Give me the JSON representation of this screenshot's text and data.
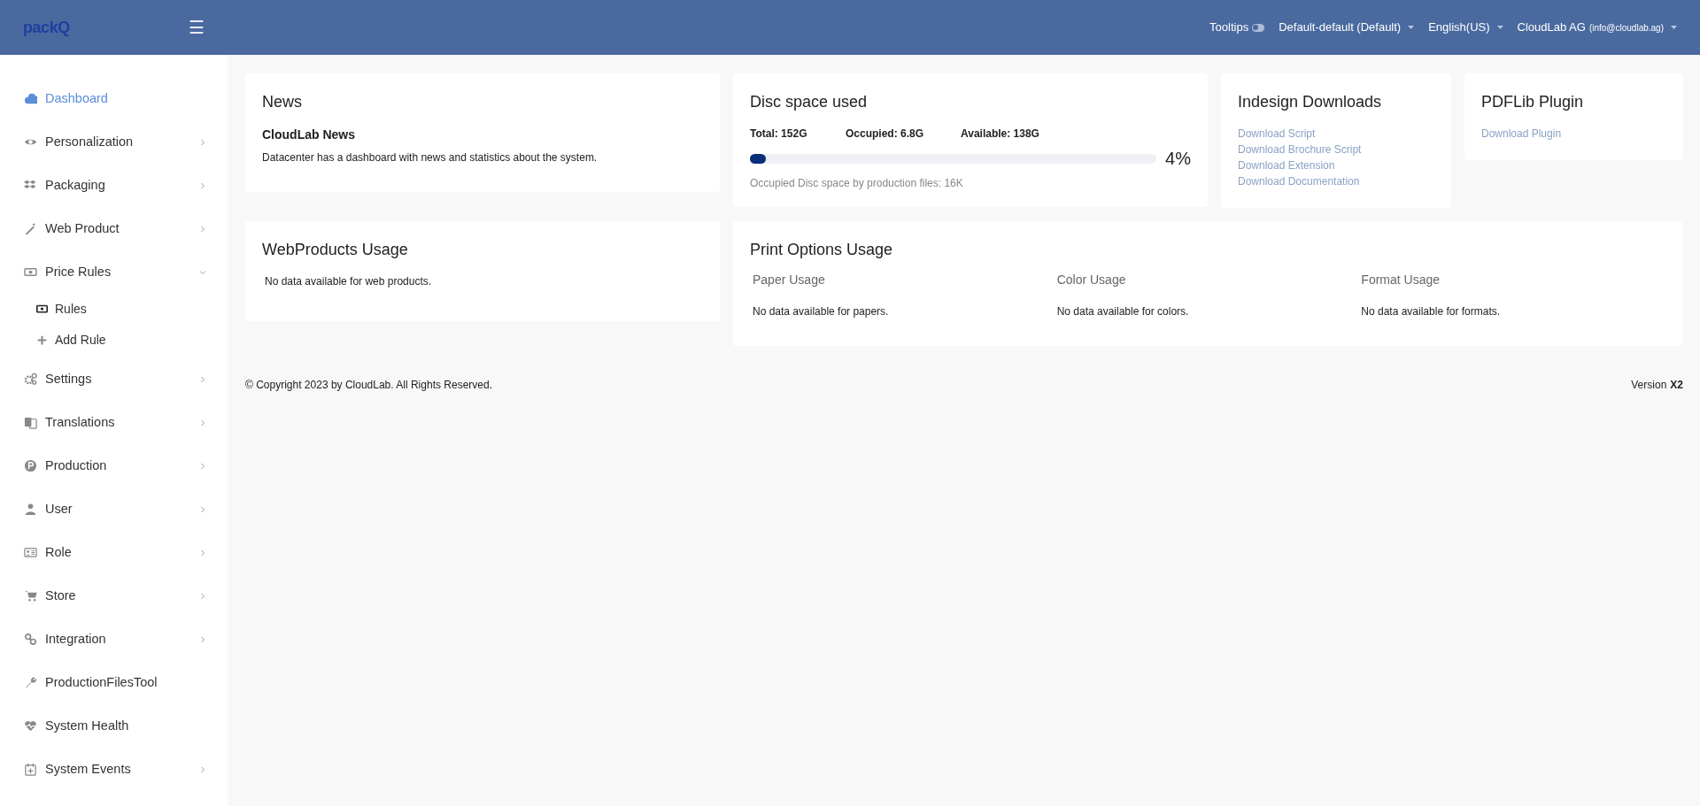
{
  "header": {
    "logo": "packQ",
    "menu_glyph": "☰",
    "tooltips": {
      "label": "Tooltips",
      "on": false
    },
    "dropdowns": [
      {
        "label": "Default-default (Default)"
      },
      {
        "label": "English(US)"
      },
      {
        "label": "CloudLab AG",
        "detail": "(info@cloudlab.ag)"
      }
    ]
  },
  "sidebar": {
    "items": [
      {
        "label": "Dashboard",
        "selected": true
      },
      {
        "label": "Personalization",
        "selected": false,
        "expanded": false
      },
      {
        "label": "Packaging",
        "selected": false,
        "expanded": false
      },
      {
        "label": "Web Product",
        "selected": false,
        "expanded": false
      },
      {
        "label": "Price Rules",
        "selected": false,
        "expanded": true,
        "children": [
          {
            "label": "Rules"
          },
          {
            "label": "Add Rule"
          }
        ]
      },
      {
        "label": "Settings",
        "selected": false,
        "expanded": false
      },
      {
        "label": "Translations",
        "selected": false,
        "expanded": false
      },
      {
        "label": "Production",
        "selected": false,
        "expanded": false
      },
      {
        "label": "User",
        "selected": false,
        "expanded": false
      },
      {
        "label": "Role",
        "selected": false,
        "expanded": false
      },
      {
        "label": "Store",
        "selected": false,
        "expanded": false
      },
      {
        "label": "Integration",
        "selected": false,
        "expanded": false
      },
      {
        "label": "ProductionFilesTool",
        "selected": false
      },
      {
        "label": "System Health",
        "selected": false
      },
      {
        "label": "System Events",
        "selected": false,
        "expanded": false
      }
    ]
  },
  "news": {
    "title": "News",
    "subtitle": "CloudLab News",
    "text": "Datacenter has a dashboard with news and statistics about the system."
  },
  "disc": {
    "title": "Disc space used",
    "stats": [
      "Total: 152G",
      "Occupied: 6.8G",
      "Available: 138G"
    ],
    "level": 0.04,
    "percent": "4%",
    "note": "Occupied Disc space by production files: 16K"
  },
  "indesign": {
    "title": "Indesign Downloads",
    "links": [
      "Download Script",
      "Download Brochure Script",
      "Download Extension",
      "Download Documentation"
    ]
  },
  "pdflib": {
    "title": "PDFLib Plugin",
    "links": [
      "Download Plugin"
    ]
  },
  "webproducts": {
    "title": "WebProducts Usage",
    "text": "No data available for web products."
  },
  "print_options": {
    "title": "Print Options Usage",
    "columns": [
      {
        "heading": "Paper Usage",
        "text": "No data available for papers."
      },
      {
        "heading": "Color Usage",
        "text": "No data available for colors."
      },
      {
        "heading": "Format Usage",
        "text": "No data available for formats."
      }
    ]
  },
  "footer": {
    "copyright": "© Copyright 2023 by CloudLab. All Rights Reserved.",
    "version_label": "Version",
    "version": "X2"
  }
}
